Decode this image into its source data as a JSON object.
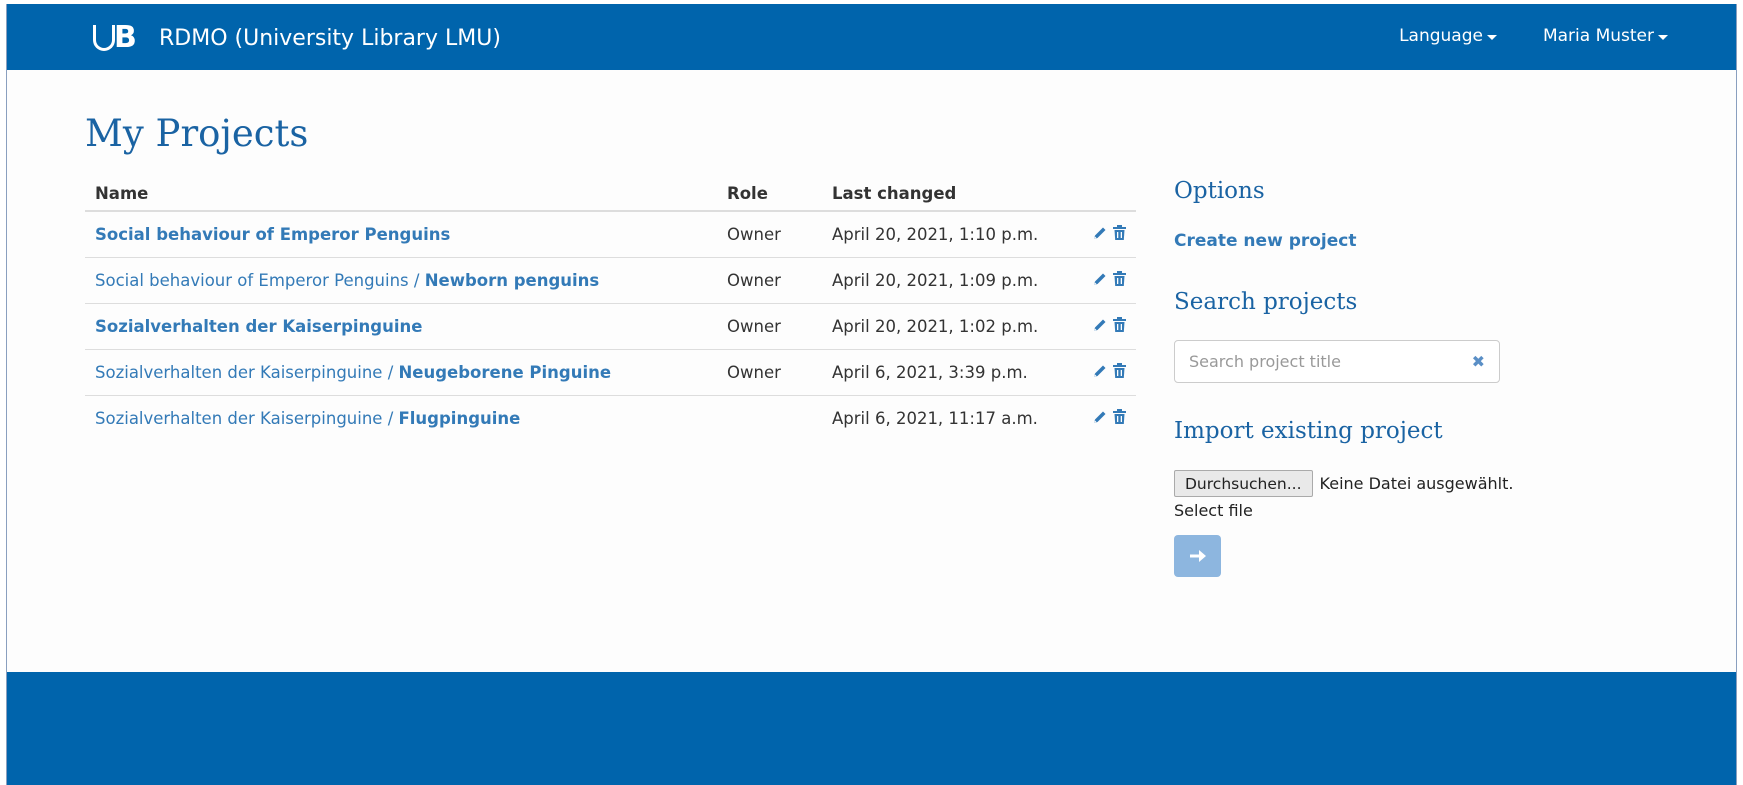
{
  "brand": {
    "title": "RDMO (University Library LMU)"
  },
  "nav": {
    "language": "Language",
    "user": "Maria Muster"
  },
  "page": {
    "title": "My Projects"
  },
  "table": {
    "headers": {
      "name": "Name",
      "role": "Role",
      "last_changed": "Last changed"
    },
    "rows": [
      {
        "parent": "",
        "title": "Social behaviour of Emperor Penguins",
        "role": "Owner",
        "last_changed": "April 20, 2021, 1:10 p.m."
      },
      {
        "parent": "Social behaviour of Emperor Penguins / ",
        "title": "Newborn penguins",
        "role": "Owner",
        "last_changed": "April 20, 2021, 1:09 p.m."
      },
      {
        "parent": "",
        "title": "Sozialverhalten der Kaiserpinguine",
        "role": "Owner",
        "last_changed": "April 20, 2021, 1:02 p.m."
      },
      {
        "parent": "Sozialverhalten der Kaiserpinguine / ",
        "title": "Neugeborene Pinguine",
        "role": "Owner",
        "last_changed": "April 6, 2021, 3:39 p.m."
      },
      {
        "parent": "Sozialverhalten der Kaiserpinguine / ",
        "title": "Flugpinguine",
        "role": "",
        "last_changed": "April 6, 2021, 11:17 a.m."
      }
    ]
  },
  "sidebar": {
    "options_title": "Options",
    "create_link": "Create new project",
    "search_title": "Search projects",
    "search_placeholder": "Search project title",
    "import_title": "Import existing project",
    "file_button": "Durchsuchen...",
    "file_status": "Keine Datei ausgewählt.",
    "select_label": "Select file"
  },
  "icons": {
    "edit": "pencil-icon",
    "delete": "trash-icon",
    "clear": "close-icon",
    "submit": "arrow-right-icon"
  },
  "colors": {
    "primary": "#0064ac",
    "heading": "#1a63a3",
    "link": "#337ab7",
    "submit_disabled": "#8db6df"
  }
}
